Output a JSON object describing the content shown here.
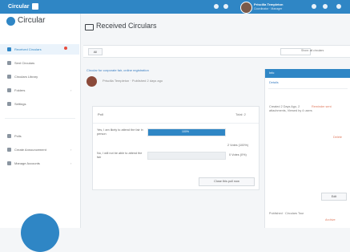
{
  "topbar": {
    "brand": "Circular",
    "user_name": "Priscilla Templeton",
    "user_sub": "Coordinator · Manager"
  },
  "sidebar": {
    "logo": "Circular",
    "items": [
      {
        "label": "Received Circulars",
        "active": true,
        "badge": true
      },
      {
        "label": "Sent Circulars"
      },
      {
        "label": "Circulars Library"
      },
      {
        "label": "Folders",
        "arrow": "›"
      },
      {
        "label": "Settings"
      },
      {
        "label": "Polls"
      },
      {
        "label": "Create Announcement",
        "arrow": "›"
      },
      {
        "label": "Manage Accounts",
        "arrow": "›"
      }
    ]
  },
  "page": {
    "title": "Received Circulars"
  },
  "toolbar": {
    "btn": "All",
    "search": "Search",
    "right": "Show: all circulars"
  },
  "circular": {
    "link": "Circular for corporate fair, online registration",
    "person": "Priscilla Templeton · Published 2 days ago"
  },
  "poll": {
    "head": "Poll",
    "head_r": "Total: 2",
    "options": [
      {
        "label": "Yes, I am likely to attend the fair in person",
        "pct": "100%",
        "fill": 1.0
      },
      {
        "label": "No, I will not be able to attend the fair",
        "pct": "",
        "fill": 0.0
      }
    ],
    "counts": [
      "2 Votes (100%)",
      "0 Votes (0%)"
    ],
    "button": "Close this poll now"
  },
  "right_panel": {
    "head": "Info",
    "label": "Details",
    "rows": [
      {
        "text": "Created 2 Days Ago, 2 attachments, Viewed by 4 users",
        "red": "Reminder sent"
      },
      {
        "text": "",
        "red": "Delete"
      }
    ],
    "btn": "Edit",
    "footer": "Published · Circulars Tour",
    "footer_red": "Archive"
  }
}
